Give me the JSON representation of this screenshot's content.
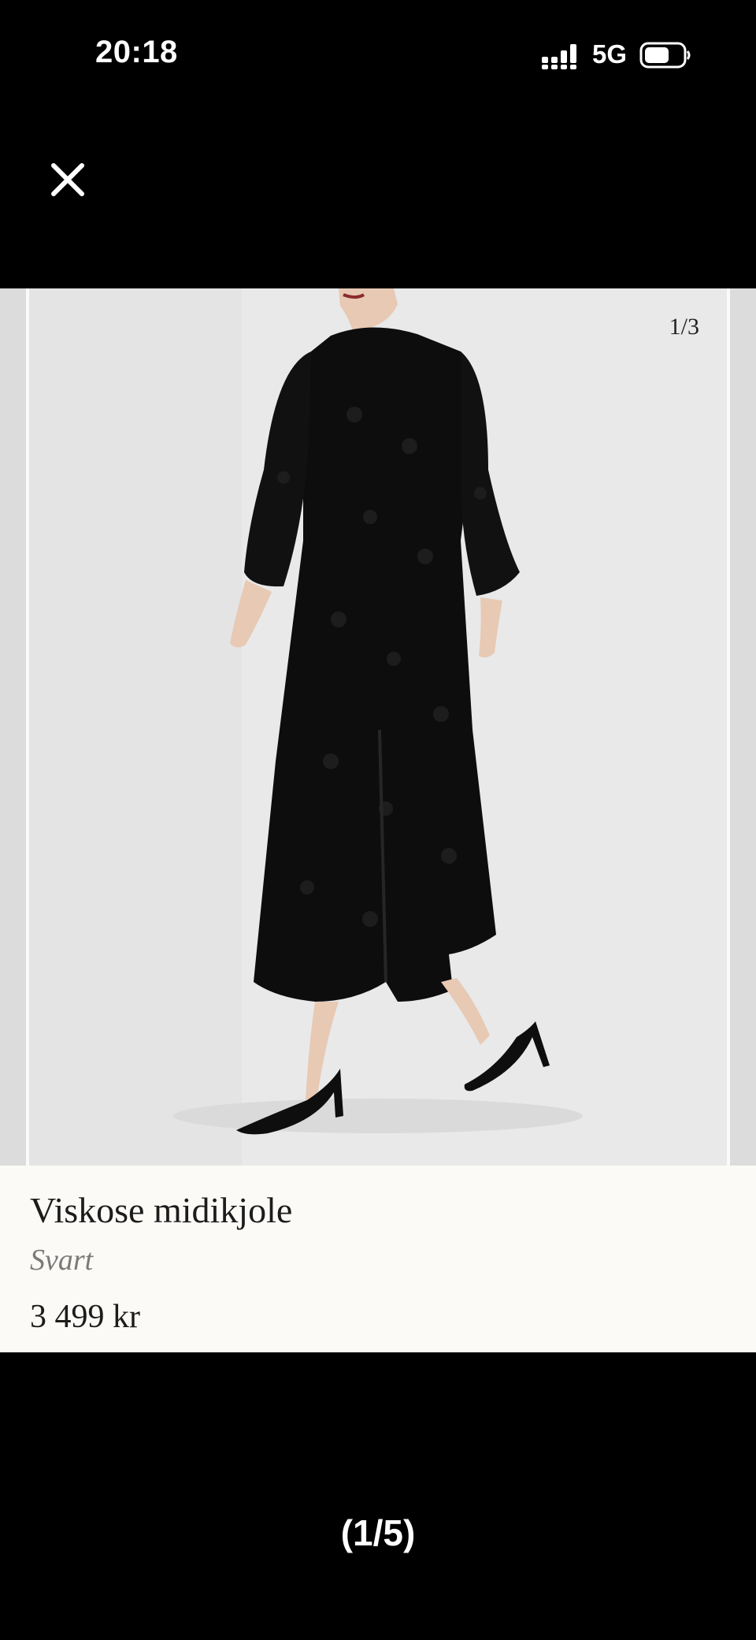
{
  "status_bar": {
    "time": "20:18",
    "network": "5G",
    "icons": [
      "signal-icon",
      "battery-icon"
    ]
  },
  "viewer": {
    "close_icon": "close-icon",
    "image_counter": "1/3",
    "image_subject": "dress"
  },
  "product": {
    "name": "Viskose midikjole",
    "color": "Svart",
    "price": "3 499 kr"
  },
  "page_indicator": "(1/5)",
  "colors": {
    "background": "#000000",
    "photo_backdrop": "#e8e8e9",
    "info_panel": "#fbfaf7",
    "dress": "#0d0d0d"
  }
}
